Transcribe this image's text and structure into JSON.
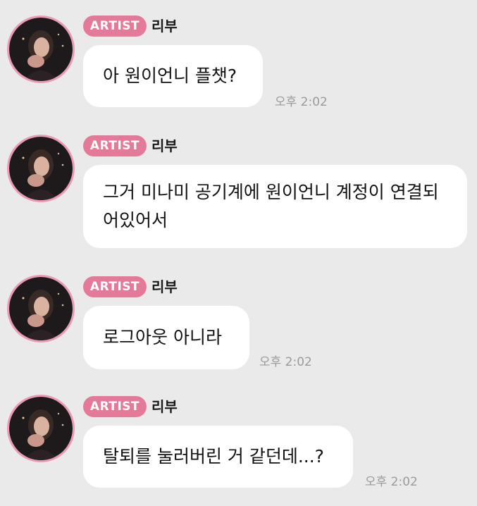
{
  "colors": {
    "background": "#eaeaea",
    "badge": "#e47a9a",
    "avatar_ring": "#ec9ab3",
    "bubble": "#ffffff",
    "time": "#9a9a9a"
  },
  "messages": [
    {
      "badge": "ARTIST",
      "sender": "리부",
      "text": "아 원이언니 플챗?",
      "time": "오후 2:02"
    },
    {
      "badge": "ARTIST",
      "sender": "리부",
      "text": "그거 미나미 공기계에 원이언니 계정이 연결되어있어서",
      "time": ""
    },
    {
      "badge": "ARTIST",
      "sender": "리부",
      "text": "로그아웃 아니라",
      "time": "오후 2:02"
    },
    {
      "badge": "ARTIST",
      "sender": "리부",
      "text": "탈퇴를 눌러버린 거 같던데...?",
      "time": "오후 2:02"
    }
  ]
}
